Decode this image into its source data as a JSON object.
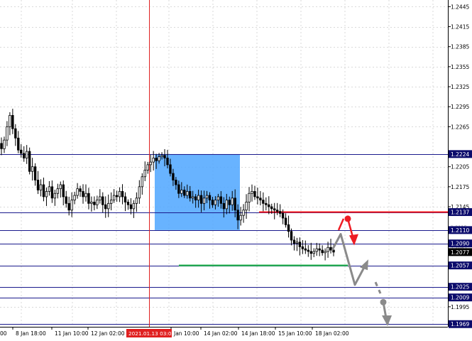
{
  "chart_data": {
    "type": "candlestick",
    "symbol_timeframe": "EURUSD H4",
    "colors": {
      "background": "#ffffff",
      "grid": "#d9d9d9",
      "axis": "#000000",
      "candle": "#000000",
      "level_line": "#1a1a8c",
      "red_level": "#ff1a1a",
      "green_level": "#22b14c",
      "highlight_box": "#4da6ff",
      "forecast_arrow": "#8a8a8a",
      "signal_arrow": "#ee1c24",
      "vertical_marker": "#e02020",
      "price_tag_dark": "#0b0b6b",
      "current_price_tag": "#000000"
    },
    "price_axis_ticks": [
      "1.2445",
      "1.2415",
      "1.2385",
      "1.2355",
      "1.2325",
      "1.2295",
      "1.2265",
      "1.2205",
      "1.2175",
      "1.2145",
      "1.1995"
    ],
    "level_tags": [
      "1.2224",
      "1.2137",
      "1.2110",
      "1.2090",
      "1.2057",
      "1.2025",
      "1.2009",
      "1.1969"
    ],
    "faint_ticks": [
      "1.2115",
      "1.2085"
    ],
    "current_price": "1.2077",
    "time_axis_labels": [
      "8 Jan 18:00",
      "11 Jan 10:00",
      "12 Jan 02:00",
      "Jan 10:00",
      "14 Jan 02:00",
      "14 Jan 18:00",
      "15 Jan 10:00",
      "18 Jan 02:00"
    ],
    "left_partial_label": "00",
    "highlighted_time": "2021.01.13 03:00",
    "ylim": [
      1.1965,
      1.2455
    ],
    "candle_closes": [
      1.2232,
      1.2245,
      1.2265,
      1.2282,
      1.2262,
      1.2248,
      1.223,
      1.2225,
      1.2218,
      1.2228,
      1.2198,
      1.2205,
      1.2185,
      1.217,
      1.2178,
      1.216,
      1.2168,
      1.2175,
      1.2158,
      1.2165,
      1.2172,
      1.2178,
      1.216,
      1.215,
      1.214,
      1.2155,
      1.2162,
      1.2172,
      1.2168,
      1.216,
      1.2165,
      1.215,
      1.2152,
      1.2148,
      1.2155,
      1.216,
      1.2148,
      1.2142,
      1.215,
      1.2155,
      1.2162,
      1.216,
      1.2168,
      1.216,
      1.2152,
      1.2148,
      1.2142,
      1.215,
      1.2158,
      1.2175,
      1.219,
      1.22,
      1.2208,
      1.2212,
      1.2218,
      1.2214,
      1.222,
      1.2222,
      1.2218,
      1.2208,
      1.2195,
      1.2185,
      1.2178,
      1.2165,
      1.217,
      1.2162,
      1.2168,
      1.2158,
      1.216,
      1.2155,
      1.2162,
      1.215,
      1.2158,
      1.2162,
      1.2155,
      1.2148,
      1.2155,
      1.216,
      1.215,
      1.2142,
      1.2155,
      1.2148,
      1.2158,
      1.214,
      1.2125,
      1.2132,
      1.214,
      1.2152,
      1.2165,
      1.2168,
      1.216,
      1.2158,
      1.2155,
      1.215,
      1.2148,
      1.2145,
      1.2142,
      1.214,
      1.2138,
      1.2135,
      1.2128,
      1.2118,
      1.2108,
      1.2095,
      1.209,
      1.2092,
      1.2085,
      1.2082,
      1.208,
      1.2078,
      1.2075,
      1.2078,
      1.2082,
      1.208,
      1.2076,
      1.2078,
      1.2084,
      1.208,
      1.2077
    ]
  }
}
